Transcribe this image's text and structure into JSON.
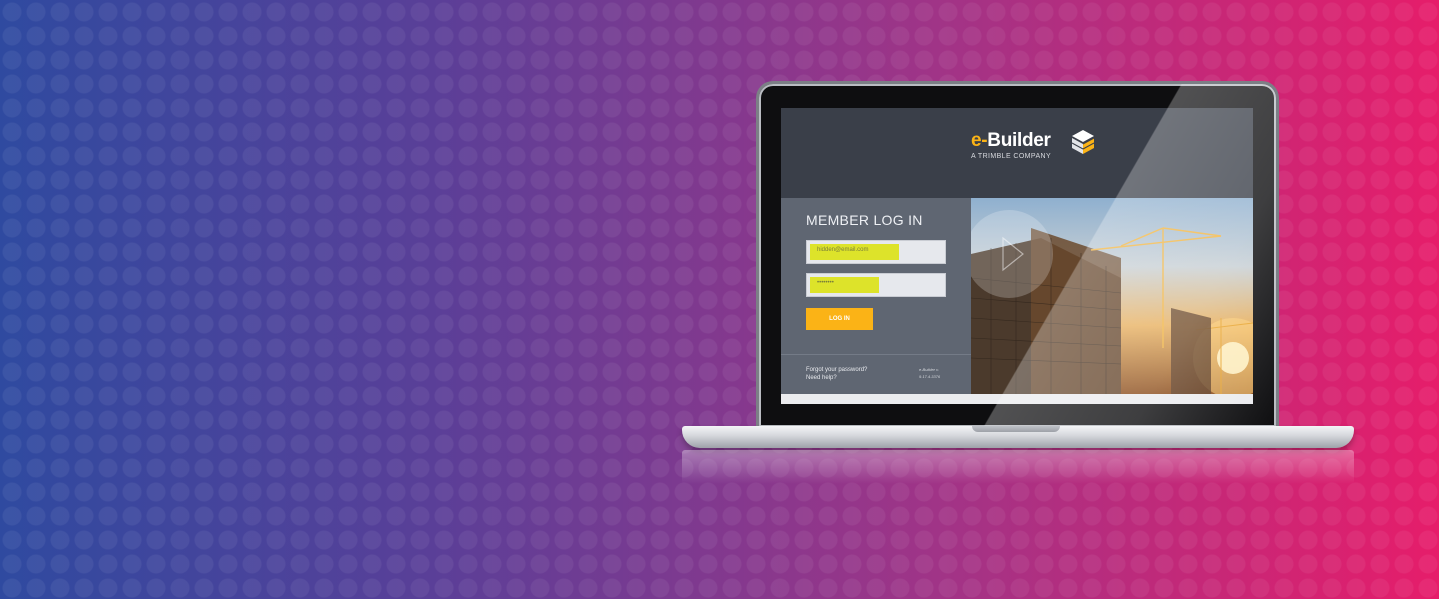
{
  "app": {
    "logo_text_e": "e-",
    "logo_text_rest": "Builder",
    "logo_sub": "A TRIMBLE COMPANY"
  },
  "login": {
    "title": "MEMBER LOG IN",
    "username_value": "hidden@email.com",
    "password_value": "••••••••",
    "login_button": "LOG IN",
    "forgot_password": "Forgot your password?",
    "need_help": "Need help?",
    "version_line1": "e-Builder v.",
    "version_line2": "9.17.4.3376"
  },
  "colors": {
    "brand_accent": "#fbb316",
    "highlight": "#dde32a",
    "header_bg": "#3a3f49",
    "panel_bg": "#5f6672"
  },
  "icons": {
    "logo": "cube-stack-icon",
    "play": "play-icon"
  }
}
